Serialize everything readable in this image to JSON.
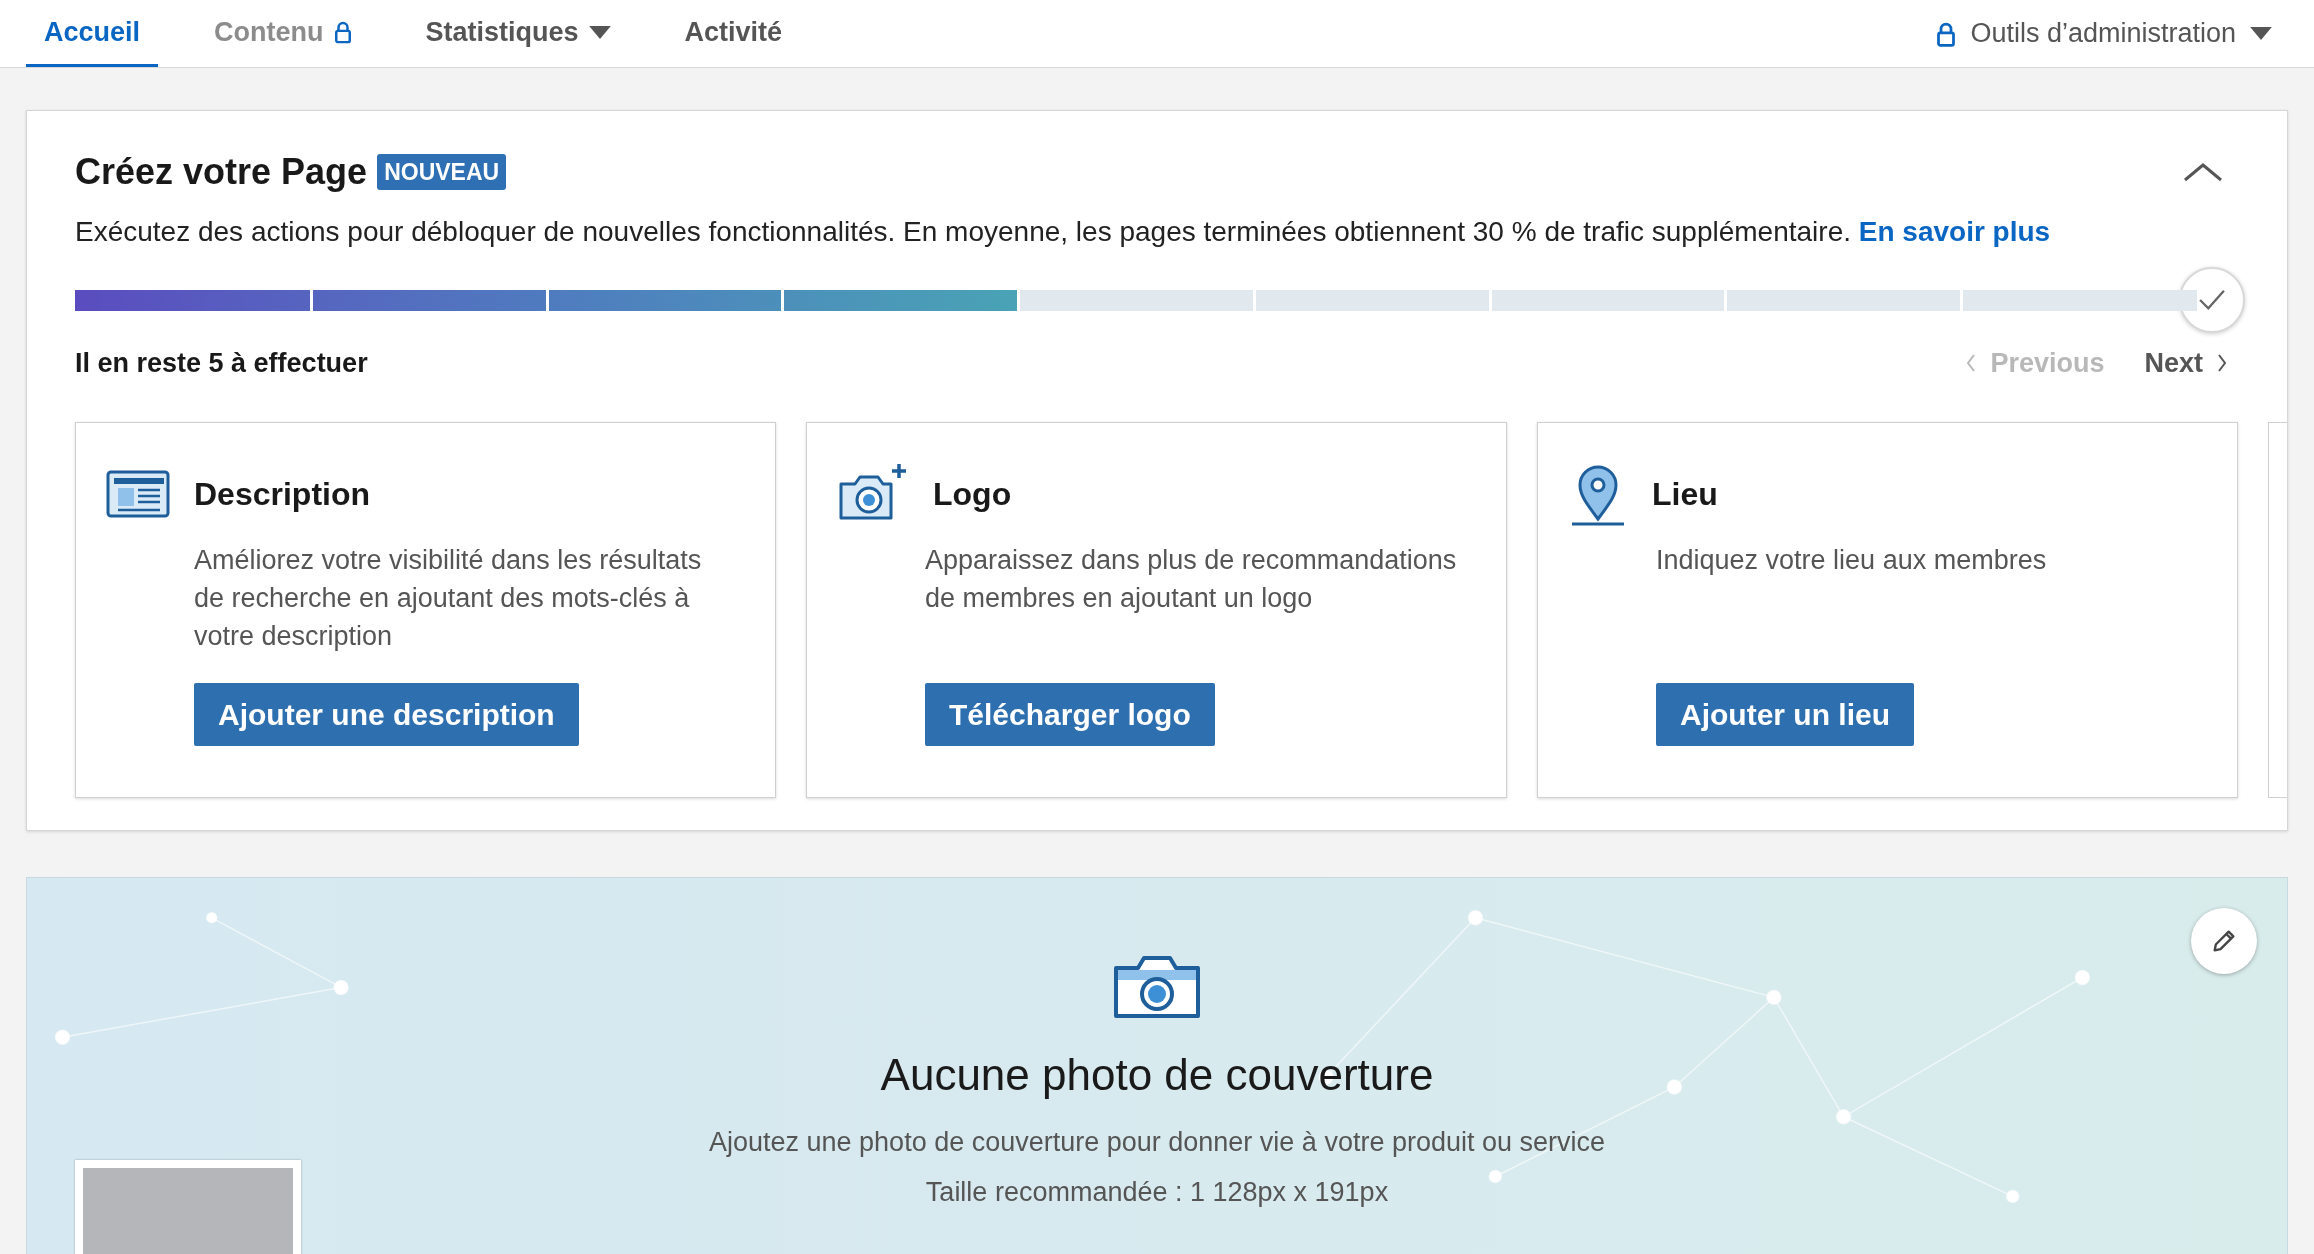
{
  "nav": {
    "tabs": [
      {
        "label": "Accueil",
        "selected": true,
        "locked": false,
        "dropdown": false
      },
      {
        "label": "Contenu",
        "selected": false,
        "locked": true,
        "dropdown": false
      },
      {
        "label": "Statistiques",
        "selected": false,
        "locked": false,
        "dropdown": true
      },
      {
        "label": "Activité",
        "selected": false,
        "locked": false,
        "dropdown": false
      }
    ],
    "admin": {
      "label": "Outils d’administration"
    }
  },
  "setup": {
    "title": "Créez votre Page",
    "badge": "NOUVEAU",
    "expanded": true,
    "description": "Exécutez des actions pour débloquer de nouvelles fonctionnalités. En moyenne, les pages terminées obtiennent 30 % de trafic supplémentaire.",
    "link": "En savoir plus",
    "progress": {
      "level": 0.444
    },
    "remaining": "Il en reste 5 à effectuer",
    "pager": [
      {
        "label": "Previous",
        "disabled": true,
        "kind": "previous"
      },
      {
        "label": "Next",
        "disabled": false,
        "kind": "next"
      }
    ],
    "cards": [
      {
        "kind": "description",
        "title": "Description",
        "text": "Améliorez votre visibilité dans les résultats de recherche en ajoutant des mots-clés à votre description",
        "button": "Ajouter une description"
      },
      {
        "kind": "logo",
        "title": "Logo",
        "text": "Apparaissez dans plus de recommandations de membres en ajoutant un logo",
        "button": "Télécharger logo"
      },
      {
        "kind": "location",
        "title": "Lieu",
        "text": "Indiquez votre lieu aux membres",
        "button": "Ajouter un lieu"
      }
    ]
  },
  "cover": {
    "title": "Aucune photo de couverture",
    "text": "Ajoutez une photo de couverture pour donner vie à votre produit ou service",
    "size": "Taille recommandée : 1 128px x 191px"
  }
}
